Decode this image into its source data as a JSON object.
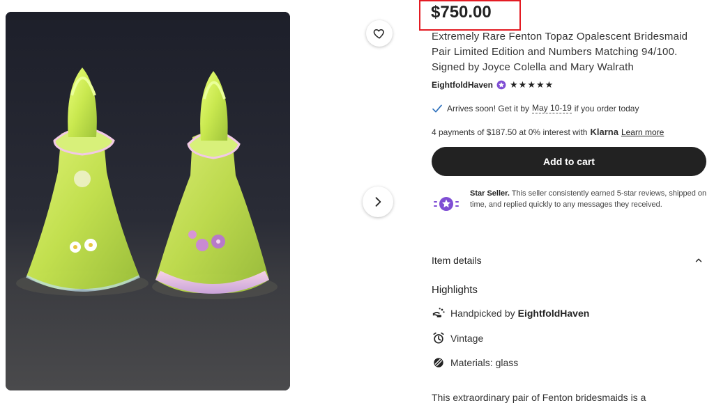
{
  "listing": {
    "price": "$750.00",
    "title": "Extremely Rare Fenton Topaz Opalescent Bridesmaid Pair Limited Edition and Numbers Matching 94/100. Signed by Joyce Colella and Mary Walrath",
    "shop_name": "EightfoldHaven",
    "rating_stars": "★★★★★",
    "rating_value": 5
  },
  "delivery": {
    "prefix": "Arrives soon! Get it by",
    "dates": "May 10-19",
    "suffix": "if you order today"
  },
  "payments": {
    "text": "4 payments of $187.50 at 0% interest with",
    "provider": "Klarna",
    "link": "Learn more"
  },
  "cart": {
    "button_label": "Add to cart"
  },
  "star_seller": {
    "title": "Star Seller.",
    "text": "This seller consistently earned 5-star reviews, shipped on time, and replied quickly to any messages they received."
  },
  "item_details": {
    "heading": "Item details",
    "highlights_heading": "Highlights",
    "handpicked_prefix": "Handpicked by",
    "handpicked_shop": "EightfoldHaven",
    "vintage": "Vintage",
    "materials": "Materials: glass",
    "description": "This extraordinary pair of Fenton bridesmaids is a"
  },
  "icons": {
    "favorite": "heart-icon",
    "next": "chevron-right-icon",
    "check": "check-icon",
    "collapse": "chevron-up-icon",
    "star_seller": "star-seller-badge-icon"
  },
  "colors": {
    "highlight_box": "#e31b23",
    "cart_button": "#222222",
    "star_seller_purple": "#7f4ed4",
    "check_blue": "#2a6ebb"
  }
}
